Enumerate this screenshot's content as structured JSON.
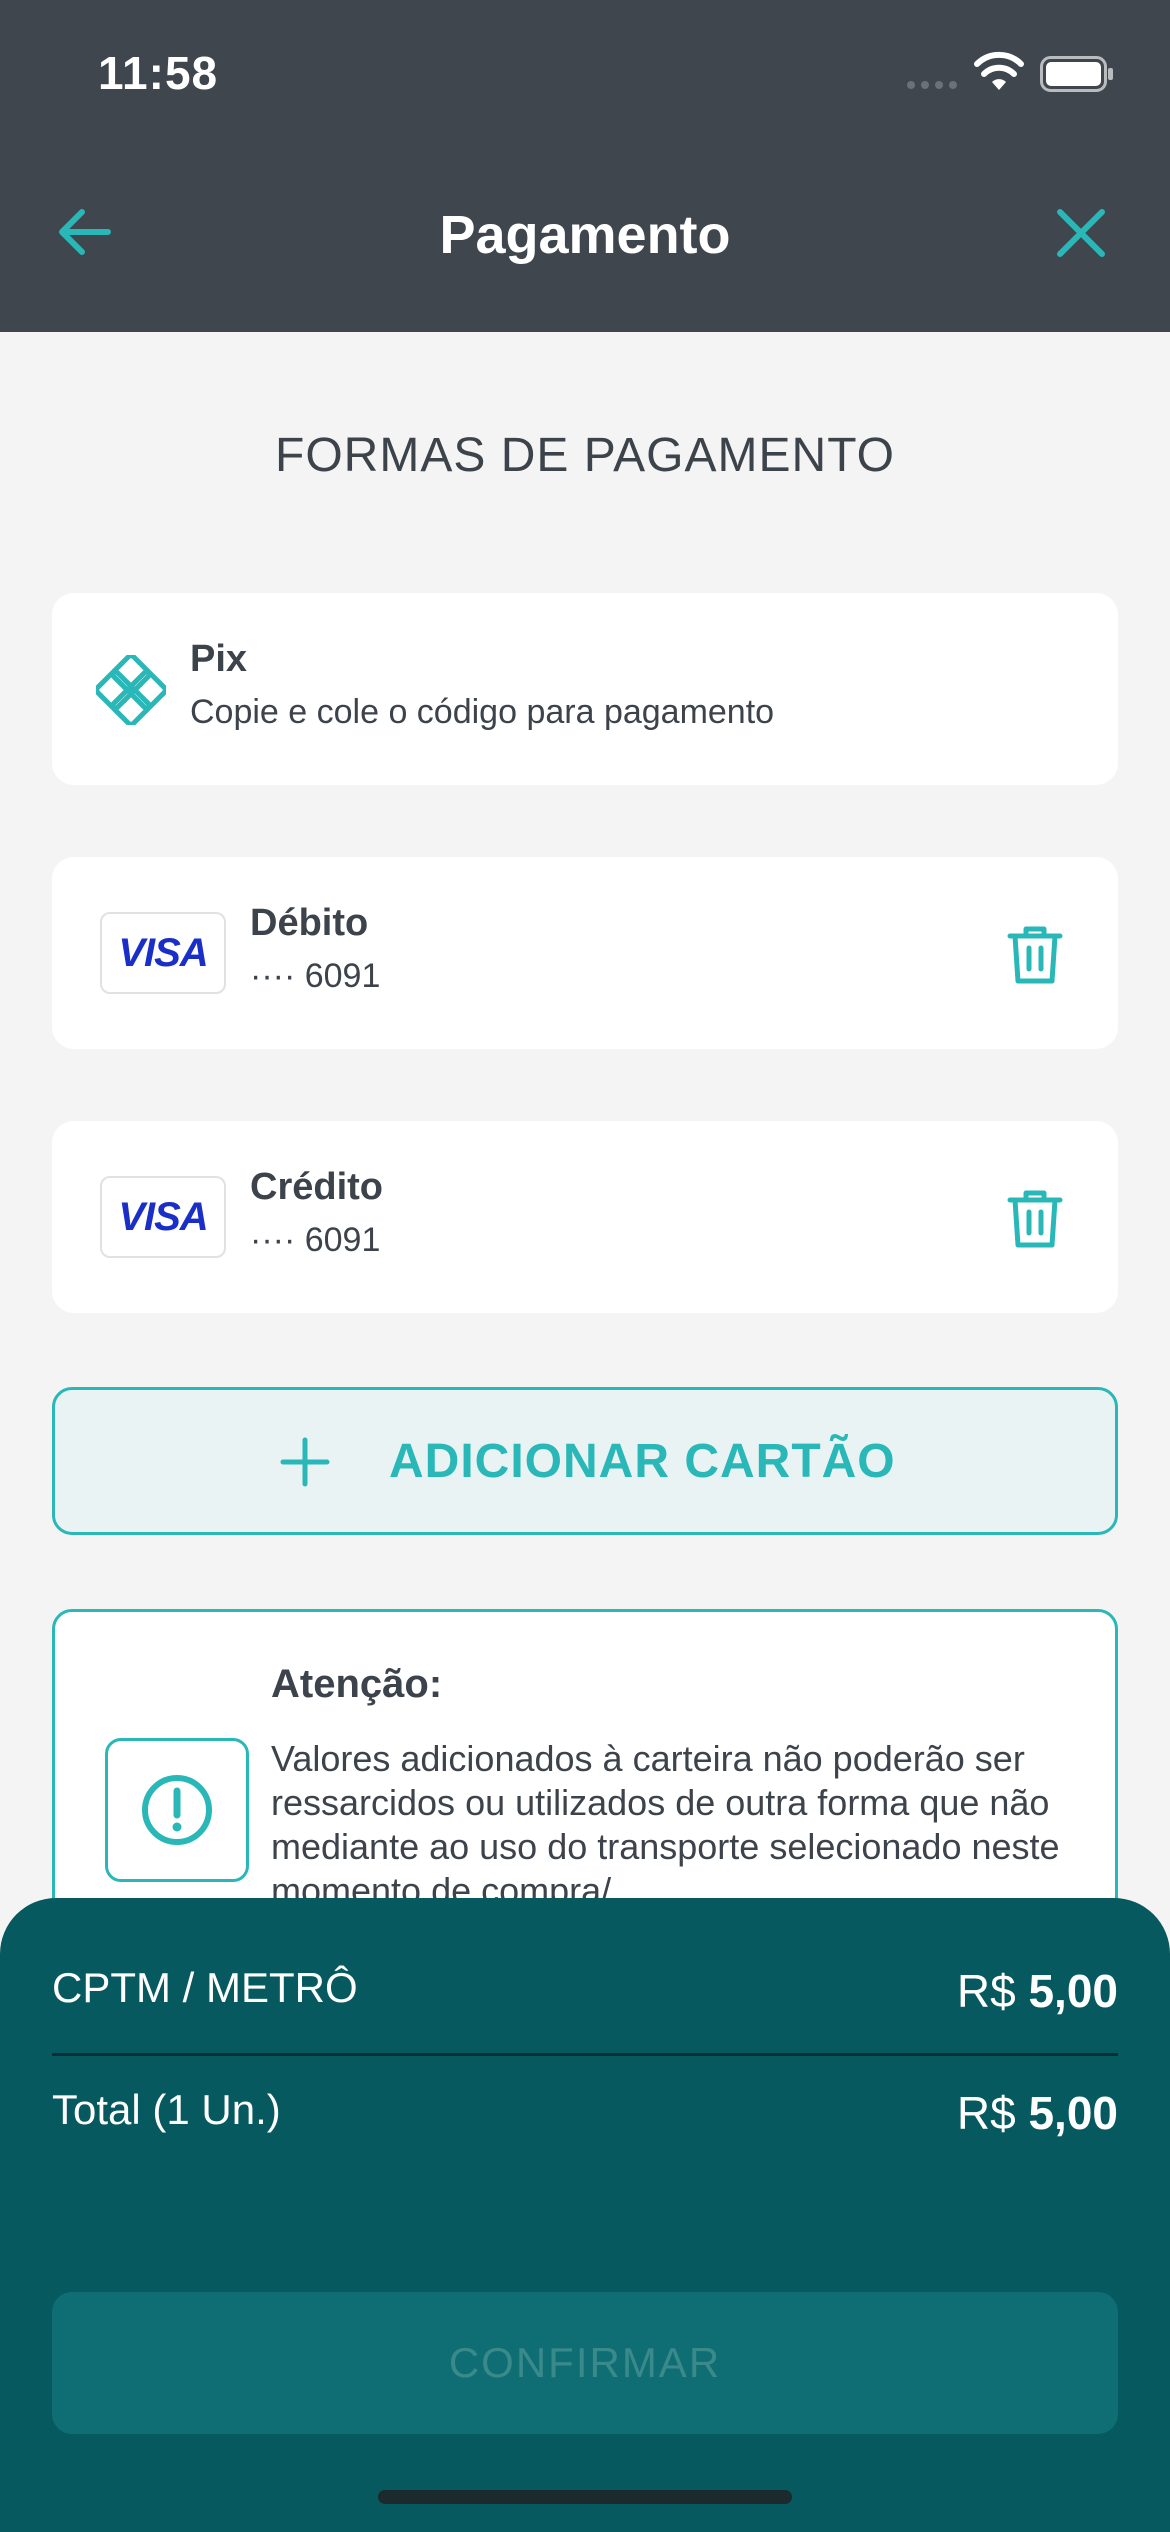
{
  "status_bar": {
    "time": "11:58"
  },
  "header": {
    "title": "Pagamento",
    "back_icon": "arrow-left-icon",
    "close_icon": "close-icon"
  },
  "section_title": "FORMAS DE PAGAMENTO",
  "payment_methods": [
    {
      "type": "pix",
      "title": "Pix",
      "subtitle": "Copie e cole o código para pagamento",
      "icon": "pix-icon"
    },
    {
      "type": "card",
      "brand": "VISA",
      "title": "Débito",
      "number": "···· 6091",
      "icon": "trash-icon"
    },
    {
      "type": "card",
      "brand": "VISA",
      "title": "Crédito",
      "number": "···· 6091",
      "icon": "trash-icon"
    }
  ],
  "add_card": {
    "label": "ADICIONAR CARTÃO",
    "icon": "plus-icon"
  },
  "warning": {
    "title": "Atenção:",
    "text": "Valores adicionados à carteira não poderão ser ressarcidos ou utilizados de outra forma que não mediante ao uso do transporte selecionado neste momento de compra/",
    "icon": "exclamation-circle-icon"
  },
  "summary": {
    "item_label": "CPTM / METRÔ",
    "item_currency": "R$",
    "item_amount": "5,00",
    "total_label": "Total (1 Un.)",
    "total_currency": "R$",
    "total_amount": "5,00"
  },
  "confirm": {
    "label": "CONFIRMAR",
    "enabled": false
  },
  "colors": {
    "header_bg": "#3f464d",
    "accent": "#2ab7b7",
    "panel_bg": "#06595f",
    "visa_blue": "#1a2ec8"
  }
}
